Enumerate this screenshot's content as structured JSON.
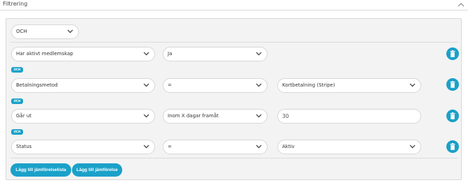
{
  "header": {
    "title": "Filtrering"
  },
  "logic_select": {
    "value": "OCH"
  },
  "rows": [
    {
      "field": "Har aktivt medlemskap",
      "operator": "Ja",
      "value": null
    },
    {
      "field": "Betalningsmetod",
      "operator": "=",
      "value": "Kortbetalning (Stripe)"
    },
    {
      "field": "Går ut",
      "operator": "Inom X dagar framåt",
      "value": "30"
    },
    {
      "field": "Status",
      "operator": "=",
      "value": "Aktiv"
    }
  ],
  "och_badges": [
    "OCH",
    "OCH",
    "OCH"
  ],
  "buttons": {
    "add_list": "Lägg till jämförelselista",
    "add_compare": "Lägg till jämförelse"
  },
  "icons": {
    "collapse": "chevron-up-icon",
    "dropdown": "chevron-down-icon",
    "delete": "trash-icon"
  },
  "colors": {
    "accent": "#1aa0c9"
  }
}
